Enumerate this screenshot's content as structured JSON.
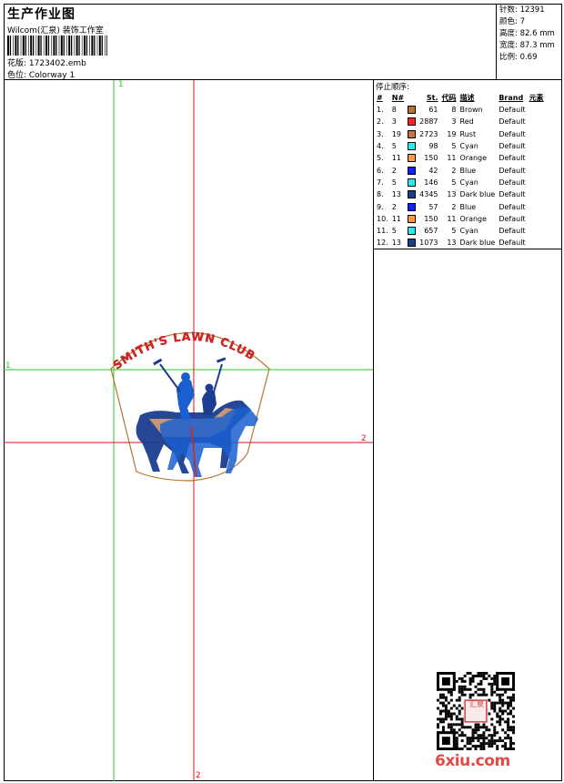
{
  "header": {
    "title": "生产作业图",
    "subtitle": "Wilcom(汇泉) 装饰工作室",
    "file": "花版: 1723402.emb",
    "colorway": "色位: Colorway 1"
  },
  "stats": {
    "stitches": "针数: 12391",
    "colors": "颜色: 7",
    "height": "高度: 82.6 mm",
    "width": "宽度: 87.3 mm",
    "scale": "比例: 0.69"
  },
  "stops": {
    "title": "停止顺序:",
    "headers": [
      "#",
      "N#",
      "St.",
      "代码",
      "描述",
      "Brand",
      "元素"
    ],
    "rows": [
      {
        "idx": "1.",
        "n": "8",
        "st": "61",
        "code": "8",
        "desc": "Brown",
        "brand": "Default",
        "color": "#b87333"
      },
      {
        "idx": "2.",
        "n": "3",
        "st": "2887",
        "code": "3",
        "desc": "Red",
        "brand": "Default",
        "color": "#ff2020"
      },
      {
        "idx": "3.",
        "n": "19",
        "st": "2723",
        "code": "19",
        "desc": "Rust",
        "brand": "Default",
        "color": "#c8743c"
      },
      {
        "idx": "4.",
        "n": "5",
        "st": "98",
        "code": "5",
        "desc": "Cyan",
        "brand": "Default",
        "color": "#20f0f0"
      },
      {
        "idx": "5.",
        "n": "11",
        "st": "150",
        "code": "11",
        "desc": "Orange",
        "brand": "Default",
        "color": "#ff9a40"
      },
      {
        "idx": "6.",
        "n": "2",
        "st": "42",
        "code": "2",
        "desc": "Blue",
        "brand": "Default",
        "color": "#1020ff"
      },
      {
        "idx": "7.",
        "n": "5",
        "st": "146",
        "code": "5",
        "desc": "Cyan",
        "brand": "Default",
        "color": "#20f0f0"
      },
      {
        "idx": "8.",
        "n": "13",
        "st": "4345",
        "code": "13",
        "desc": "Dark blue",
        "brand": "Default",
        "color": "#1a3d8f"
      },
      {
        "idx": "9.",
        "n": "2",
        "st": "57",
        "code": "2",
        "desc": "Blue",
        "brand": "Default",
        "color": "#1020ff"
      },
      {
        "idx": "10.",
        "n": "11",
        "st": "150",
        "code": "11",
        "desc": "Orange",
        "brand": "Default",
        "color": "#ff9a40"
      },
      {
        "idx": "11.",
        "n": "5",
        "st": "657",
        "code": "5",
        "desc": "Cyan",
        "brand": "Default",
        "color": "#20f0f0"
      },
      {
        "idx": "12.",
        "n": "13",
        "st": "1073",
        "code": "13",
        "desc": "Dark blue",
        "brand": "Default",
        "color": "#1a3d8f"
      }
    ]
  },
  "design": {
    "arc_text": "SMITH'S LAWN CLUB",
    "colors": {
      "red": "#e02020",
      "dark_blue": "#1a3d8f",
      "blue": "#1a5fd0",
      "outline": "#b87333",
      "rust": "#d8a070"
    }
  },
  "guides": {
    "green_v_label": "1",
    "green_h_label": "1",
    "red_v_label": "2",
    "red_h_label": "2",
    "green": "#22cc22",
    "red": "#dd1111"
  },
  "watermark": {
    "seal_text": "汇泉",
    "site": "6xiu.com"
  }
}
